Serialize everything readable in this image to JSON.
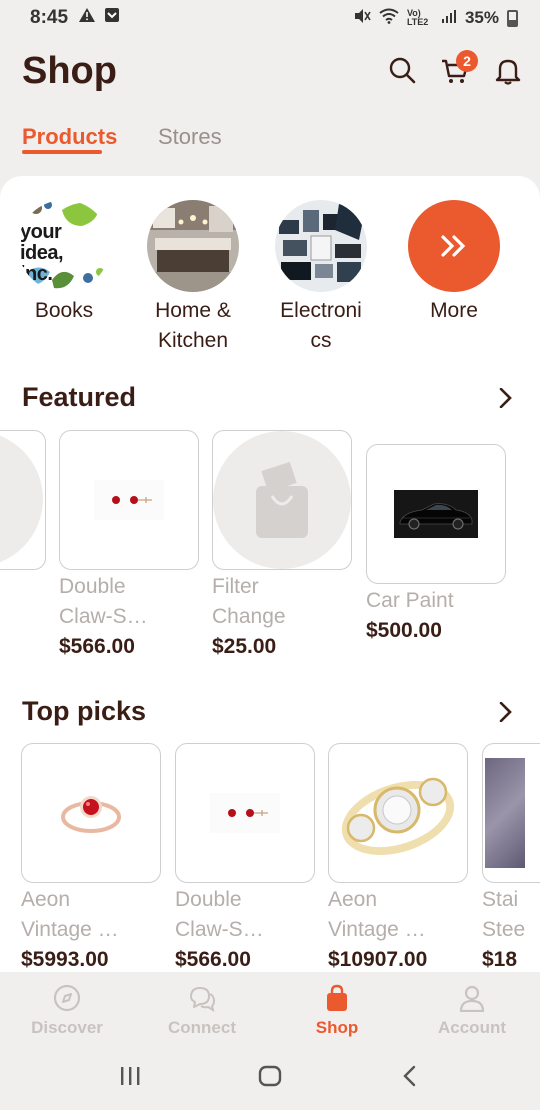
{
  "status": {
    "time": "8:45",
    "battery": "35%",
    "network_label": "Vo) LTE2"
  },
  "header": {
    "title": "Shop",
    "cart_count": "2",
    "tabs": [
      {
        "label": "Products",
        "active": true
      },
      {
        "label": "Stores",
        "active": false
      }
    ]
  },
  "categories": [
    {
      "label": "Books",
      "logo_text": "your idea, inc."
    },
    {
      "label": "Home & Kitchen"
    },
    {
      "label": "Electronics"
    },
    {
      "label": "More",
      "icon": "double-chevron-right-icon"
    }
  ],
  "featured": {
    "title": "Featured",
    "items": [
      {
        "name": "Double Claw-S…",
        "price": "$566.00"
      },
      {
        "name": "Filter Change",
        "price": "$25.00"
      },
      {
        "name": "Car Paint",
        "price": "$500.00"
      }
    ]
  },
  "top_picks": {
    "title": "Top picks",
    "items": [
      {
        "name": "Aeon Vintage …",
        "price": "$5993.00"
      },
      {
        "name": "Double Claw-S…",
        "price": "$566.00"
      },
      {
        "name": "Aeon Vintage …",
        "price": "$10907.00"
      },
      {
        "name": "Stai Stee",
        "price": "$18"
      }
    ]
  },
  "bottom_nav": [
    {
      "label": "Discover",
      "icon": "compass-icon",
      "active": false
    },
    {
      "label": "Connect",
      "icon": "chat-bubbles-icon",
      "active": false
    },
    {
      "label": "Shop",
      "icon": "shopping-bag-icon",
      "active": true
    },
    {
      "label": "Account",
      "icon": "person-icon",
      "active": false
    }
  ],
  "colors": {
    "accent": "#ea5a2e",
    "title_text": "#3a1e16",
    "muted_text": "#b5aeab",
    "background": "#f1efee"
  }
}
